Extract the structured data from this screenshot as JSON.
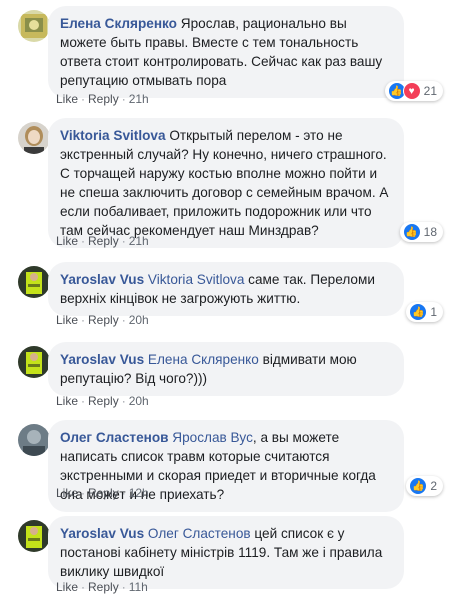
{
  "actions": {
    "like": "Like",
    "reply": "Reply"
  },
  "comments": [
    {
      "author": "Елена Скляренко",
      "reply_to": "",
      "text": "Ярослав, рационально вы можете быть правы. Вместе с тем тональность ответа стоит контролировать. Сейчас как раз вашу репутацию отмывать пора",
      "time": "21h",
      "reactions": {
        "types": [
          "like-icon",
          "love-icon"
        ],
        "count": "21"
      }
    },
    {
      "author": "Viktoria Svitlova",
      "reply_to": "",
      "text": "Открытый перелом - это не экстренный случай? Ну конечно, ничего страшного. С торчащей наружу костью вполне можно пойти и не спеша заключить договор с семейным врачом. А если побаливает, приложить подорожник или что там сейчас рекомендует наш Минздрав?",
      "time": "21h",
      "reactions": {
        "types": [
          "like-icon"
        ],
        "count": "18"
      }
    },
    {
      "author": "Yaroslav Vus",
      "reply_to": "Viktoria Svitlova",
      "text": "саме так. Переломи верхніх кінцівок не загрожують життю.",
      "time": "20h",
      "reactions": {
        "types": [
          "like-icon"
        ],
        "count": "1"
      }
    },
    {
      "author": "Yaroslav Vus",
      "reply_to": "Елена Скляренко",
      "text": "відмивати мою репутацію? Від чого?)))",
      "time": "20h",
      "reactions": {
        "types": [],
        "count": ""
      }
    },
    {
      "author": "Олег Сластенов",
      "reply_to": "Ярослав Вус",
      "text": ", а вы можете написать список травм которые считаются экстренными и скорая приедет и вторичные когда она может и не приехать?",
      "time": "12h",
      "reactions": {
        "types": [
          "like-icon"
        ],
        "count": "2"
      }
    },
    {
      "author": "Yaroslav Vus",
      "reply_to": "Олег Сластенов",
      "text": "цей список є у постанові кабінету міністрів 1119. Там же і правила виклику швидкої",
      "time": "11h",
      "reactions": {
        "types": [],
        "count": ""
      }
    }
  ]
}
